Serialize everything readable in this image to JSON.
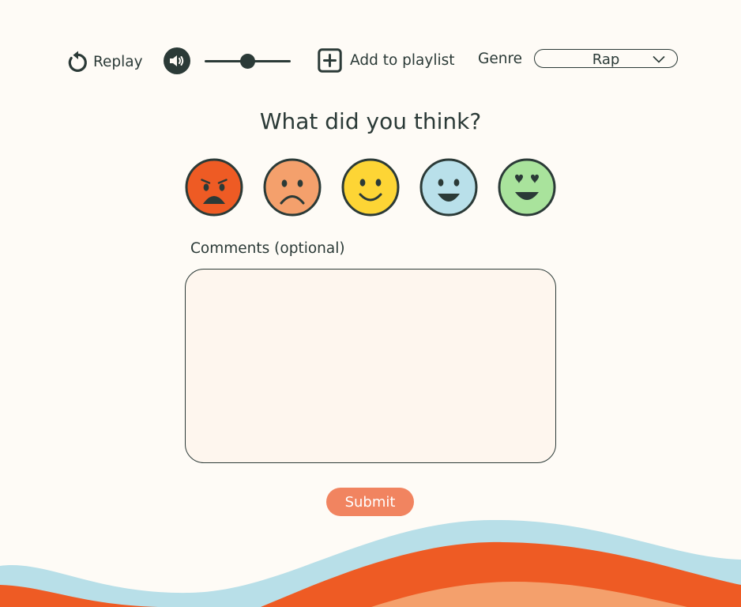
{
  "toolbar": {
    "replay_label": "Replay",
    "replay_icon": "replay-icon",
    "volume_icon": "volume-icon",
    "volume_level": 0.5,
    "add_to_playlist_label": "Add to playlist",
    "add_icon": "plus-square-icon",
    "genre_label": "Genre",
    "genre_selected": "Rap",
    "genre_dropdown_icon": "chevron-down-icon"
  },
  "rating": {
    "question": "What did you think?",
    "faces": [
      {
        "icon": "very-sad-face-icon",
        "color": "#ee5b24"
      },
      {
        "icon": "sad-face-icon",
        "color": "#f4a06c"
      },
      {
        "icon": "smile-face-icon",
        "color": "#fdd535"
      },
      {
        "icon": "happy-face-icon",
        "color": "#b9e0ea"
      },
      {
        "icon": "heart-eyes-face-icon",
        "color": "#a9e39c"
      }
    ]
  },
  "comments": {
    "label": "Comments (optional)",
    "value": "",
    "placeholder": ""
  },
  "submit_label": "Submit",
  "colors": {
    "background": "#fefbf6",
    "ink": "#2b3a37",
    "accent": "#f18460",
    "wave_blue": "#b8dfe8",
    "wave_orange": "#ee5b24",
    "wave_peach": "#f4a06c"
  }
}
